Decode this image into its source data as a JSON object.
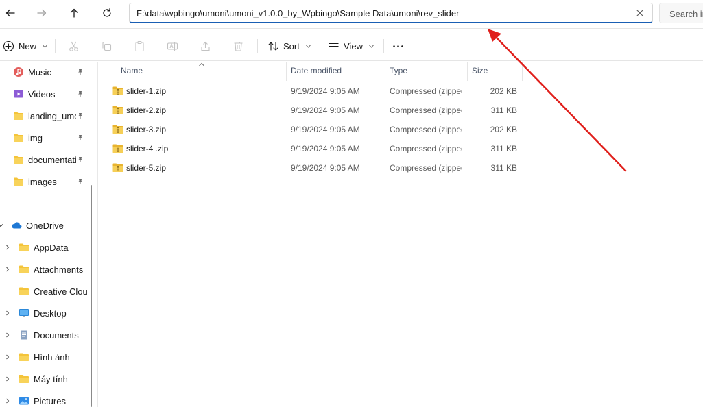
{
  "address_bar": {
    "path": "F:\\data\\wpbingo\\umoni\\umoni_v1.0.0_by_Wpbingo\\Sample Data\\umoni\\rev_slider",
    "search_placeholder": "Search in"
  },
  "nav": {
    "back_icon": "arrow-left-icon",
    "forward_icon": "arrow-right-icon",
    "up_icon": "arrow-up-icon",
    "refresh_icon": "refresh-icon"
  },
  "toolbar": {
    "new_label": "New",
    "sort_label": "Sort",
    "view_label": "View",
    "more_label": "···"
  },
  "sidebar": {
    "quick_access": [
      {
        "label": "Music",
        "icon": "music-icon",
        "pinned": true
      },
      {
        "label": "Videos",
        "icon": "videos-icon",
        "pinned": true
      },
      {
        "label": "landing_umoni",
        "icon": "folder-icon",
        "pinned": true
      },
      {
        "label": "img",
        "icon": "folder-icon",
        "pinned": true
      },
      {
        "label": "documentation",
        "icon": "folder-icon",
        "pinned": true
      },
      {
        "label": "images",
        "icon": "folder-icon",
        "pinned": true
      }
    ],
    "onedrive": {
      "label": "OneDrive",
      "icon": "cloud-icon"
    },
    "onedrive_items": [
      {
        "label": "AppData",
        "icon": "folder-icon",
        "expandable": true
      },
      {
        "label": "Attachments",
        "icon": "folder-icon",
        "expandable": true
      },
      {
        "label": "Creative Cloud Files",
        "icon": "folder-icon",
        "expandable": false
      },
      {
        "label": "Desktop",
        "icon": "desktop-icon",
        "expandable": true
      },
      {
        "label": "Documents",
        "icon": "documents-icon",
        "expandable": true
      },
      {
        "label": "Hình ảnh",
        "icon": "folder-icon",
        "expandable": true
      },
      {
        "label": "Máy tính",
        "icon": "folder-icon",
        "expandable": true
      },
      {
        "label": "Pictures",
        "icon": "pictures-icon",
        "expandable": true
      }
    ]
  },
  "file_list": {
    "columns": {
      "name": "Name",
      "date": "Date modified",
      "type": "Type",
      "size": "Size"
    },
    "files": [
      {
        "name": "slider-1.zip",
        "date": "9/19/2024 9:05 AM",
        "type": "Compressed (zipped) Folder",
        "size": "202 KB"
      },
      {
        "name": "slider-2.zip",
        "date": "9/19/2024 9:05 AM",
        "type": "Compressed (zipped) Folder",
        "size": "311 KB"
      },
      {
        "name": "slider-3.zip",
        "date": "9/19/2024 9:05 AM",
        "type": "Compressed (zipped) Folder",
        "size": "202 KB"
      },
      {
        "name": "slider-4 .zip",
        "date": "9/19/2024 9:05 AM",
        "type": "Compressed (zipped) Folder",
        "size": "311 KB"
      },
      {
        "name": "slider-5.zip",
        "date": "9/19/2024 9:05 AM",
        "type": "Compressed (zipped) Folder",
        "size": "311 KB"
      }
    ]
  },
  "colors": {
    "accent": "#1a5fb4",
    "folder": "#f4c43a",
    "annotation_arrow": "#e0201c",
    "onedrive": "#1e78d4"
  }
}
